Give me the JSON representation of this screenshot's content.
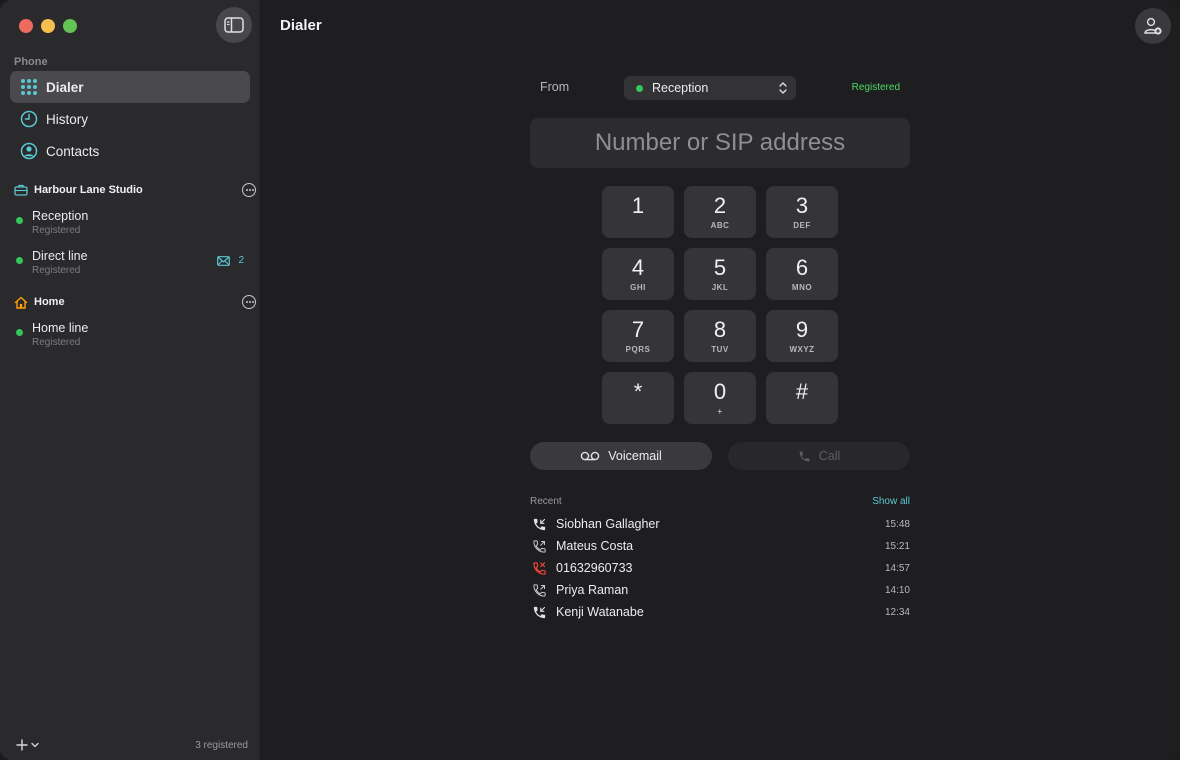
{
  "sidebar": {
    "section_label": "Phone",
    "nav": [
      {
        "label": "Dialer",
        "icon": "keypad-grid-icon"
      },
      {
        "label": "History",
        "icon": "clock-icon"
      },
      {
        "label": "Contacts",
        "icon": "person-circle-icon"
      }
    ],
    "groups": [
      {
        "name": "Harbour Lane Studio",
        "icon": "briefcase-icon",
        "lines": [
          {
            "name": "Reception",
            "status": "Registered"
          },
          {
            "name": "Direct line",
            "status": "Registered",
            "voicemail_count": "2"
          }
        ]
      },
      {
        "name": "Home",
        "icon": "house-icon",
        "lines": [
          {
            "name": "Home line",
            "status": "Registered"
          }
        ]
      }
    ],
    "footer_count": "3 registered"
  },
  "main": {
    "title": "Dialer",
    "from_label": "From",
    "from_value": "Reception",
    "registration_status": "Registered",
    "number_placeholder": "Number or SIP address",
    "keys": [
      {
        "digit": "1",
        "letters": ""
      },
      {
        "digit": "2",
        "letters": "ABC"
      },
      {
        "digit": "3",
        "letters": "DEF"
      },
      {
        "digit": "4",
        "letters": "GHI"
      },
      {
        "digit": "5",
        "letters": "JKL"
      },
      {
        "digit": "6",
        "letters": "MNO"
      },
      {
        "digit": "7",
        "letters": "PQRS"
      },
      {
        "digit": "8",
        "letters": "TUV"
      },
      {
        "digit": "9",
        "letters": "WXYZ"
      },
      {
        "digit": "*",
        "letters": ""
      },
      {
        "digit": "0",
        "letters": "+"
      },
      {
        "digit": "#",
        "letters": ""
      }
    ],
    "voicemail_label": "Voicemail",
    "call_label": "Call",
    "recent_label": "Recent",
    "show_all_label": "Show all",
    "recent": [
      {
        "name": "Siobhan Gallagher",
        "time": "15:48",
        "type": "incoming"
      },
      {
        "name": "Mateus Costa",
        "time": "15:21",
        "type": "outgoing"
      },
      {
        "name": "01632960733",
        "time": "14:57",
        "type": "missed"
      },
      {
        "name": "Priya Raman",
        "time": "14:10",
        "type": "outgoing"
      },
      {
        "name": "Kenji Watanabe",
        "time": "12:34",
        "type": "incoming"
      }
    ]
  },
  "colors": {
    "registered": "#34c759",
    "accent": "#5ac8d0",
    "missed": "#ff453a"
  }
}
